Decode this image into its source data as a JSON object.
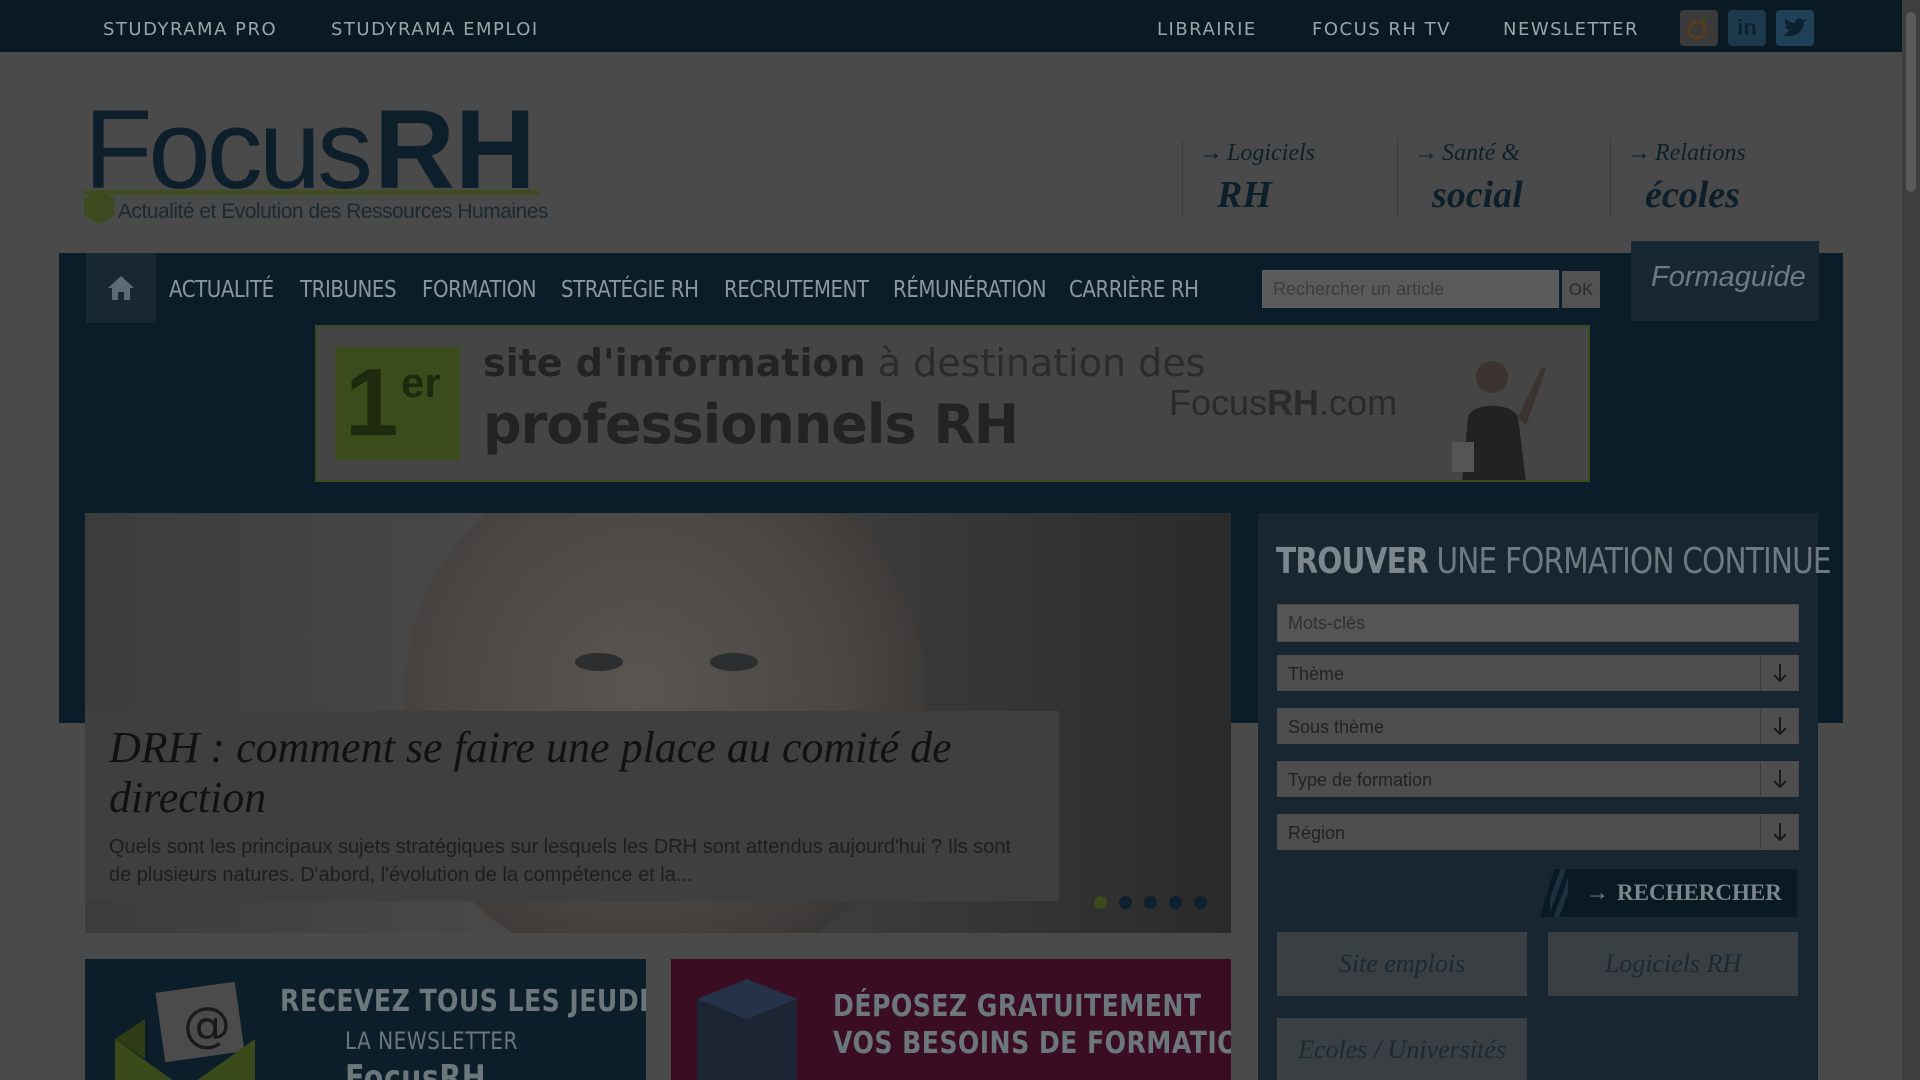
{
  "topbar": {
    "left_links": [
      "STUDYRAMA PRO",
      "STUDYRAMA EMPLOI"
    ],
    "right_links": [
      "LIBRAIRIE",
      "FOCUS RH TV",
      "NEWSLETTER"
    ],
    "social": [
      {
        "name": "viadeo-icon",
        "glyph": "ṿ",
        "color": "#5b3a1e"
      },
      {
        "name": "linkedin-icon",
        "glyph": "in",
        "color": "#1d3a4c"
      },
      {
        "name": "twitter-icon",
        "glyph": "🐦",
        "color": "#1f4056"
      }
    ]
  },
  "logo": {
    "focus": "Focus",
    "rh": "RH",
    "tagline": "Actualité et Evolution des Ressources Humaines"
  },
  "header_links": [
    {
      "line1": "Logiciels",
      "line2": "RH"
    },
    {
      "line1": "Santé &",
      "line2": "social"
    },
    {
      "line1": "Relations",
      "line2": "écoles"
    }
  ],
  "nav": {
    "items": [
      "ACTUALITÉ",
      "TRIBUNES",
      "FORMATION",
      "STRATÉGIE RH",
      "RECRUTEMENT",
      "RÉMUNÉRATION",
      "CARRIÈRE RH"
    ],
    "search_placeholder": "Rechercher un article",
    "search_button": "OK",
    "formaguide": "Formaguide"
  },
  "banner": {
    "badge_number": "1",
    "badge_suffix": "er",
    "line1_bold": "site d'information",
    "line1_rest": " à destination des",
    "line2": "professionnels RH",
    "brand_focus": "Focus",
    "brand_rh": "RH",
    "brand_tld": ".com"
  },
  "slider": {
    "title": "DRH : comment se faire une place au comité de direction",
    "excerpt": "Quels sont les principaux sujets stratégiques sur lesquels les DRH sont attendus aujourd'hui ? Ils sont de plusieurs natures. D'abord, l'évolution de la compétence et la...",
    "slide_count": 5,
    "active_slide": 1
  },
  "sidebar": {
    "title_bold": "TROUVER",
    "title_rest": " UNE FORMATION CONTINUE",
    "keywords_placeholder": "Mots-clés",
    "selects": [
      "Thème",
      "Sous thème",
      "Type de formation",
      "Région"
    ],
    "search_button": "RECHERCHER",
    "links": [
      "Site emplois",
      "Logiciels RH",
      "Ecoles / Universités"
    ]
  },
  "promos": {
    "newsletter": {
      "line1": "RECEVEZ TOUS LES JEUDIS",
      "line2": "LA NEWSLETTER",
      "line3": "FocusRH"
    },
    "formations": {
      "line1": "DÉPOSEZ GRATUITEMENT",
      "line2": "VOS BESOINS DE FORMATIONS"
    }
  }
}
